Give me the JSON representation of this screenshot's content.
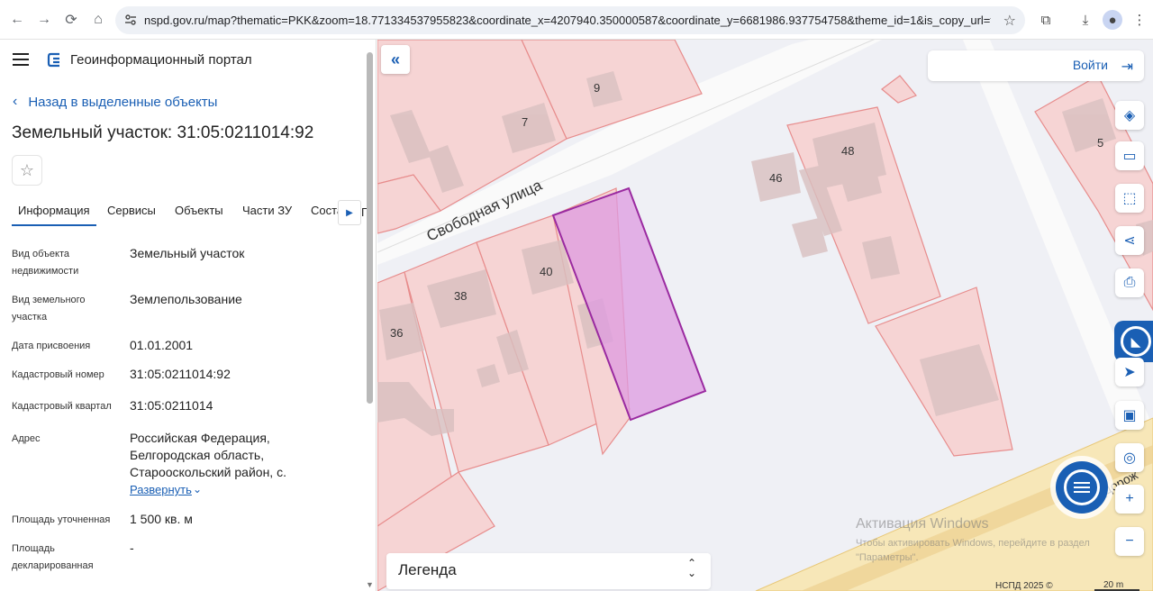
{
  "browser": {
    "url": "nspd.gov.ru/map?thematic=PKK&zoom=18.771334537955823&coordinate_x=4207940.350000587&coordinate_y=6681986.937754758&theme_id=1&is_copy_url=true&baseLayerI..."
  },
  "header": {
    "portal_title": "Геоинформационный портал"
  },
  "panel": {
    "back_label": "Назад в выделенные объекты",
    "title": "Земельный участок: 31:05:0211014:92",
    "tabs": [
      "Информация",
      "Сервисы",
      "Объекты",
      "Части ЗУ",
      "Соста",
      "П"
    ],
    "rows": [
      {
        "label": "Вид объекта недвижимости",
        "value": "Земельный участок"
      },
      {
        "label": "Вид земельного участка",
        "value": "Землепользование"
      },
      {
        "label": "Дата присвоения",
        "value": "01.01.2001"
      },
      {
        "label": "Кадастровый номер",
        "value": "31:05:0211014:92"
      },
      {
        "label": "Кадастровый квартал",
        "value": "31:05:0211014"
      },
      {
        "label": "Адрес",
        "value": "Российская Федерация, Белгородская область, Старооскольский район, с."
      },
      {
        "label": "Площадь уточненная",
        "value": "1 500 кв. м"
      },
      {
        "label": "Площадь декларированная",
        "value": "-"
      }
    ],
    "expand_label": "Развернуть"
  },
  "map": {
    "login_label": "Войти",
    "legend_label": "Легенда",
    "street_label": "Свободная улица",
    "road_label": "Дорож",
    "house_numbers": [
      "9",
      "7",
      "48",
      "46",
      "5",
      "7",
      "40",
      "38",
      "36"
    ],
    "watermark_title": "Активация Windows",
    "watermark_sub": "Чтобы активировать Windows, перейдите в раздел \"Параметры\".",
    "copyright": "НСПД 2025 ©",
    "scale": "20 m",
    "colors": {
      "parcel": "#f2c7c7",
      "selected": "#d98fd9",
      "accent": "#1a5fb4"
    }
  }
}
